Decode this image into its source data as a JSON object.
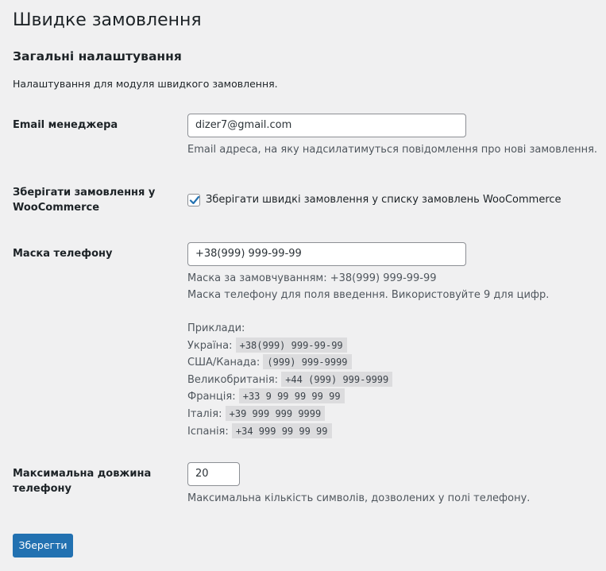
{
  "page": {
    "title": "Швидке замовлення"
  },
  "section": {
    "title": "Загальні налаштування",
    "description": "Налаштування для модуля швидкого замовлення."
  },
  "fields": {
    "email": {
      "label": "Email менеджера",
      "value": "dizer7@gmail.com",
      "description": "Email адреса, на яку надсилатимуться повідомлення про нові замовлення."
    },
    "save_orders": {
      "label_line1": "Зберігати замовлення у",
      "label_line2": "WooCommerce",
      "checked": true,
      "checkbox_label": "Зберігати швидкі замовлення у списку замовлень WooCommerce"
    },
    "phone_mask": {
      "label": "Маска телефону",
      "value": "+38(999) 999-99-99",
      "default_text": "Маска за замовчуванням: +38(999) 999-99-99",
      "help_text": "Маска телефону для поля введення. Використовуйте 9 для цифр.",
      "examples_title": "Приклади:",
      "examples": [
        {
          "country": "Україна:",
          "mask": "+38(999) 999-99-99"
        },
        {
          "country": "США/Канада:",
          "mask": "(999) 999-9999"
        },
        {
          "country": "Великобританія:",
          "mask": "+44 (999) 999-9999"
        },
        {
          "country": "Франція:",
          "mask": "+33 9 99 99 99 99"
        },
        {
          "country": "Італія:",
          "mask": "+39 999 999 9999"
        },
        {
          "country": "Іспанія:",
          "mask": "+34 999 99 99 99"
        }
      ]
    },
    "max_length": {
      "label_line1": "Максимальна довжина",
      "label_line2": "телефону",
      "value": "20",
      "description": "Максимальна кількість символів, дозволених у полі телефону."
    }
  },
  "actions": {
    "save_label": "Зберегти"
  },
  "colors": {
    "background": "#f0f0f1",
    "primary_button": "#2271b1",
    "checkbox_check": "#2271b1"
  }
}
